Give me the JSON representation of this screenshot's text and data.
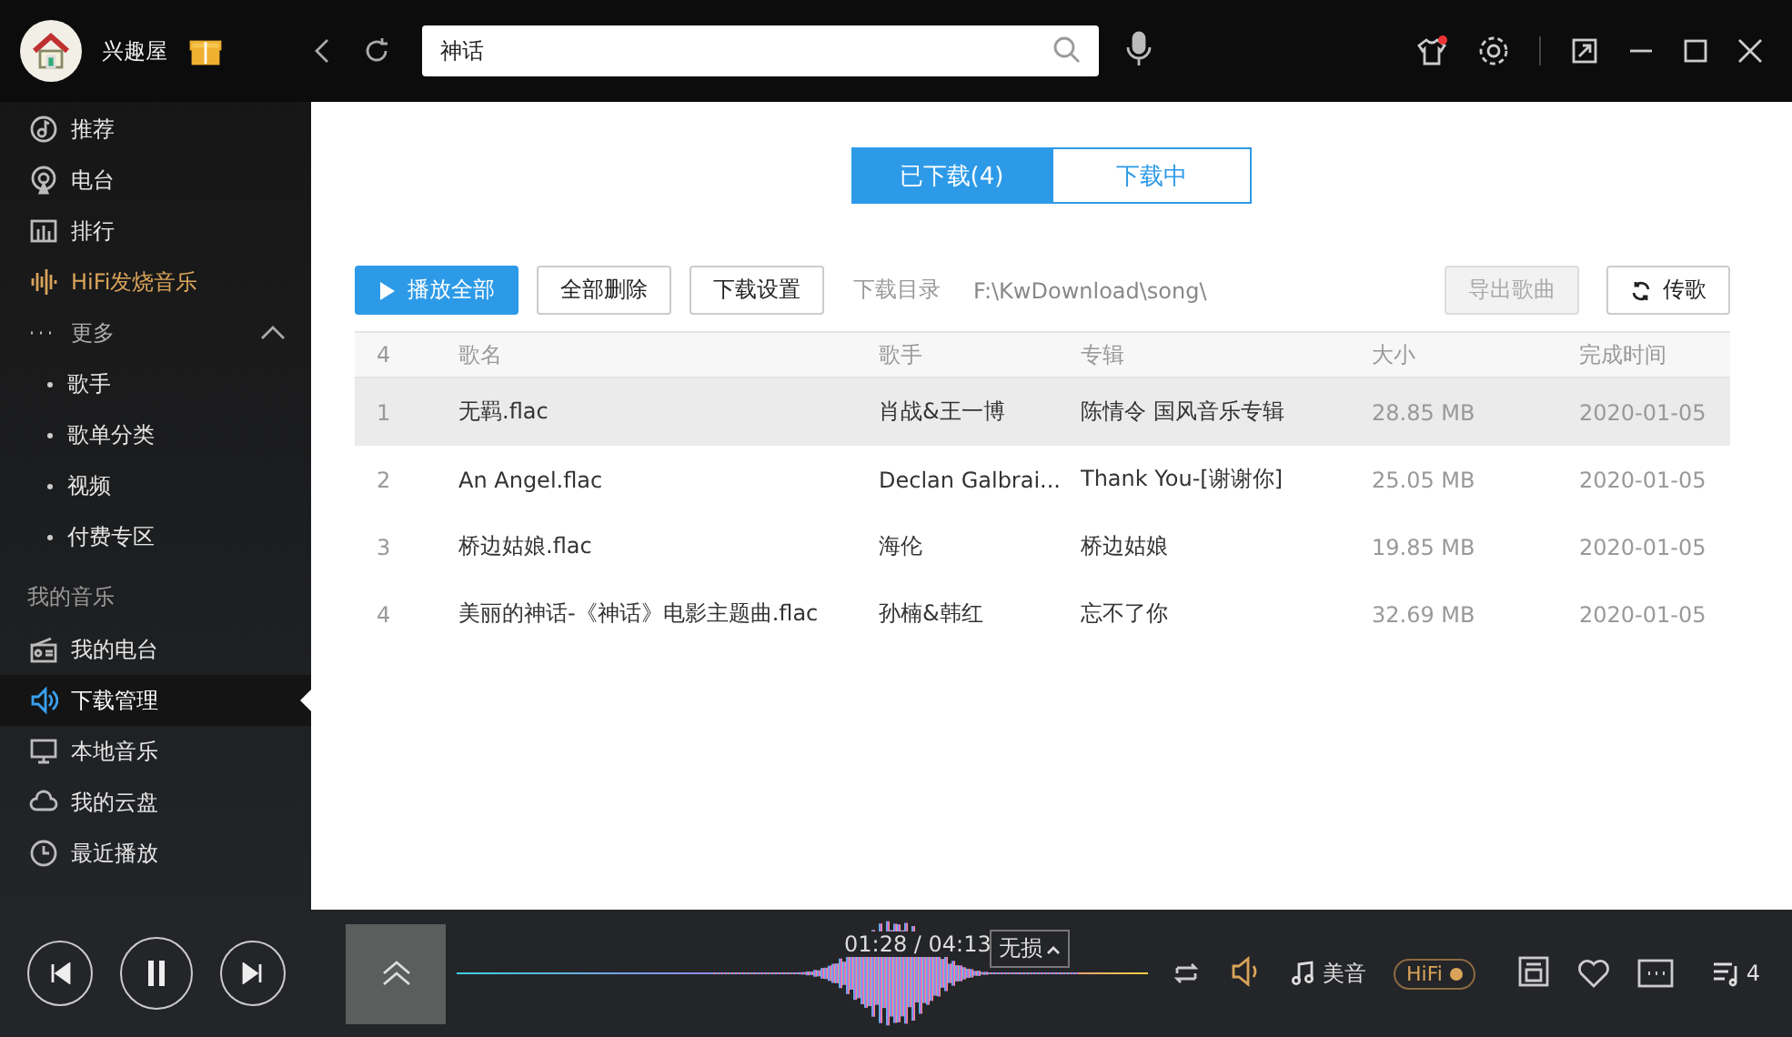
{
  "top_bar": {
    "user_name": "兴趣屋",
    "search": {
      "value": "神话"
    }
  },
  "sidebar": {
    "items": [
      {
        "kind": "nav",
        "label": "推荐",
        "selected": false
      },
      {
        "kind": "nav",
        "label": "电台",
        "selected": false
      },
      {
        "kind": "nav",
        "label": "排行",
        "selected": false
      },
      {
        "kind": "hifi",
        "label": "HiFi发烧音乐",
        "selected": false
      },
      {
        "kind": "more",
        "label": "更多",
        "expanded": true
      },
      {
        "kind": "sub",
        "label": "歌手"
      },
      {
        "kind": "sub",
        "label": "歌单分类"
      },
      {
        "kind": "sub",
        "label": "视频"
      },
      {
        "kind": "sub",
        "label": "付费专区"
      },
      {
        "kind": "section",
        "label": "我的音乐"
      },
      {
        "kind": "nav",
        "label": "我的电台",
        "selected": false
      },
      {
        "kind": "nav",
        "label": "下载管理",
        "selected": true
      },
      {
        "kind": "nav",
        "label": "本地音乐",
        "selected": false
      },
      {
        "kind": "nav",
        "label": "我的云盘",
        "selected": false
      },
      {
        "kind": "nav",
        "label": "最近播放",
        "selected": false
      }
    ]
  },
  "tabs": [
    {
      "label": "已下载(4)",
      "selected": true
    },
    {
      "label": "下载中",
      "selected": false
    }
  ],
  "toolbar": {
    "buttons": [
      {
        "label": "播放全部",
        "kind": "primary",
        "disabled": false
      },
      {
        "label": "全部删除",
        "kind": "plain",
        "disabled": false
      },
      {
        "label": "下载设置",
        "kind": "plain",
        "disabled": false
      }
    ],
    "directory_label": "下载目录",
    "directory_path": "F:\\KwDownload\\song\\",
    "right_buttons": [
      {
        "label": "导出歌曲",
        "kind": "plain",
        "disabled": true
      },
      {
        "label": "传歌",
        "kind": "sync",
        "disabled": false
      }
    ]
  },
  "table": {
    "columns": [
      "4",
      "歌名",
      "歌手",
      "专辑",
      "大小",
      "完成时间"
    ],
    "rows": [
      {
        "cells": [
          "1",
          "无羁.flac",
          "肖战&王一博",
          "陈情令  国风音乐专辑",
          "28.85 MB",
          "2020-01-05"
        ],
        "selected": true
      },
      {
        "cells": [
          "2",
          "An Angel.flac",
          "Declan Galbrai...",
          "Thank  You-[谢谢你]",
          "25.05 MB",
          "2020-01-05"
        ],
        "selected": false
      },
      {
        "cells": [
          "3",
          "桥边姑娘.flac",
          "海伦",
          "桥边姑娘",
          "19.85 MB",
          "2020-01-05"
        ],
        "selected": false
      },
      {
        "cells": [
          "4",
          "美丽的神话-《神话》电影主题曲.flac",
          "孙楠&韩红",
          "忘不了你",
          "32.69 MB",
          "2020-01-05"
        ],
        "selected": false
      }
    ]
  },
  "player": {
    "time": "01:28 / 04:13",
    "quality": "无损",
    "effect": "美音",
    "hifi": {
      "label": "HiFi",
      "on": true
    },
    "playing": true,
    "queue_count": "4"
  }
}
